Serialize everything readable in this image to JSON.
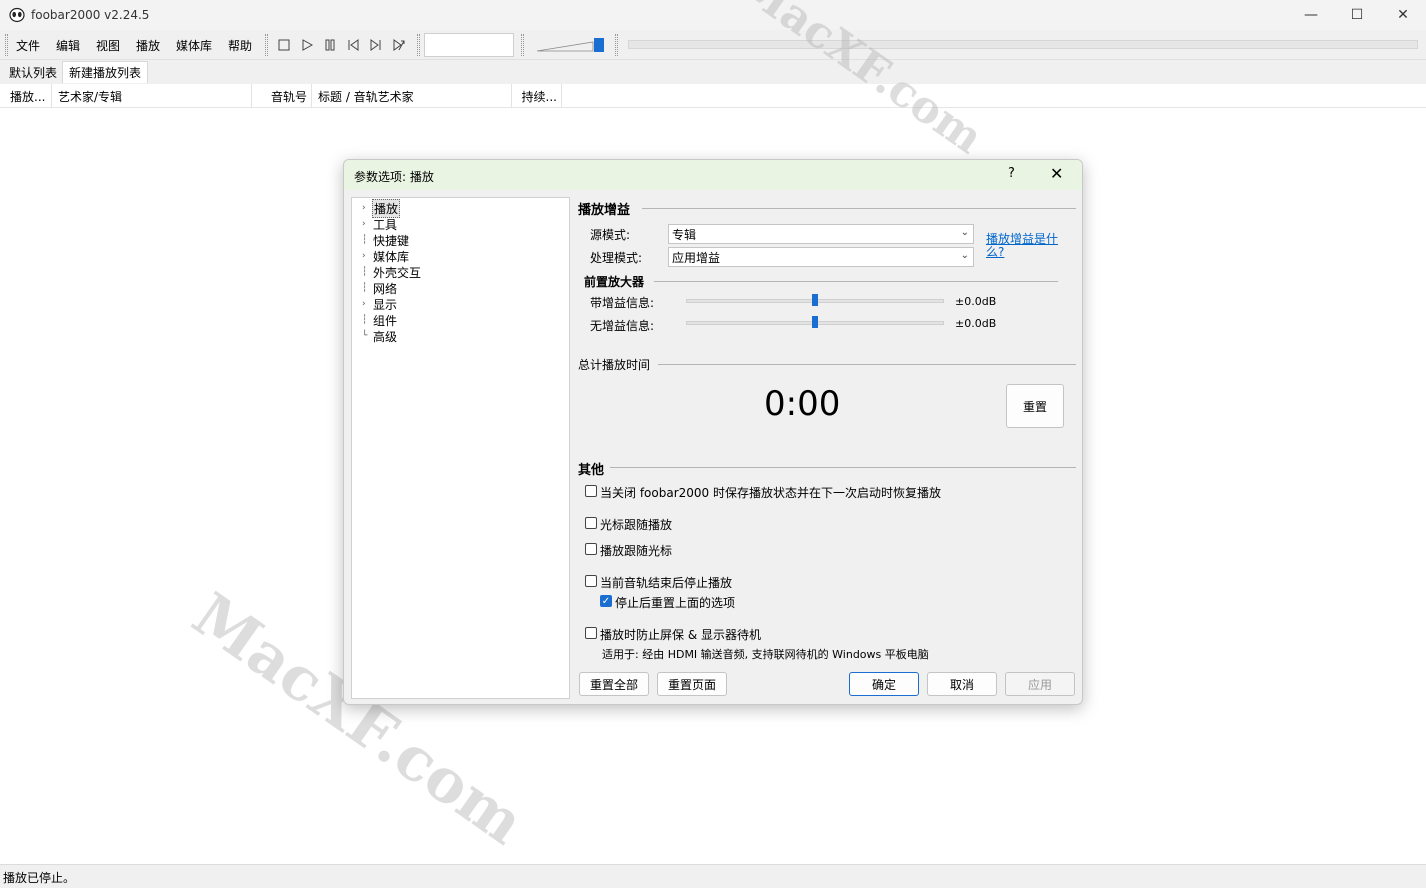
{
  "window": {
    "title": "foobar2000 v2.24.5",
    "minimize": "—",
    "maximize": "☐",
    "close": "✕"
  },
  "menu": [
    "文件",
    "编辑",
    "视图",
    "播放",
    "媒体库",
    "帮助"
  ],
  "playlist_tabs": [
    "默认列表",
    "新建播放列表"
  ],
  "columns": [
    "播放...",
    "艺术家/专辑",
    "音轨号",
    "标题 / 音轨艺术家",
    "持续..."
  ],
  "status": "播放已停止。",
  "watermark": "MacXF.com",
  "dialog": {
    "title": "参数选项: 播放",
    "help": "?",
    "close": "✕",
    "tree": [
      {
        "label": "播放",
        "expandable": true
      },
      {
        "label": "工具",
        "expandable": true
      },
      {
        "label": "快捷键",
        "expandable": false
      },
      {
        "label": "媒体库",
        "expandable": true
      },
      {
        "label": "外壳交互",
        "expandable": false
      },
      {
        "label": "网络",
        "expandable": false
      },
      {
        "label": "显示",
        "expandable": true
      },
      {
        "label": "组件",
        "expandable": false
      },
      {
        "label": "高级",
        "expandable": false
      }
    ],
    "replaygain": {
      "heading": "播放增益",
      "source_label": "源模式:",
      "source_value": "专辑",
      "process_label": "处理模式:",
      "process_value": "应用增益",
      "help_link": "播放增益是什么?",
      "preamp_heading": "前置放大器",
      "with_label": "带增益信息:",
      "with_value": "±0.0dB",
      "with_level": 0.5,
      "without_label": "无增益信息:",
      "without_value": "±0.0dB",
      "without_level": 0.5
    },
    "total_time": {
      "heading": "总计播放时间",
      "value": "0:00",
      "reset": "重置"
    },
    "other": {
      "heading": "其他",
      "options": [
        {
          "label": "当关闭 foobar2000 时保存播放状态并在下一次启动时恢复播放",
          "checked": false
        },
        {
          "label": "光标跟随播放",
          "checked": false
        },
        {
          "label": "播放跟随光标",
          "checked": false
        },
        {
          "label": "当前音轨结束后停止播放",
          "checked": false
        },
        {
          "label": "停止后重置上面的选项",
          "checked": true
        },
        {
          "label": "播放时防止屏保 & 显示器待机",
          "checked": false
        }
      ],
      "note": "适用于: 经由 HDMI 输送音频, 支持联网待机的 Windows 平板电脑"
    },
    "buttons": {
      "reset_all": "重置全部",
      "reset_page": "重置页面",
      "ok": "确定",
      "cancel": "取消",
      "apply": "应用"
    }
  },
  "colors": {
    "accent": "#1b6ed1",
    "dialog_title_bg": "#eaf4e2"
  }
}
